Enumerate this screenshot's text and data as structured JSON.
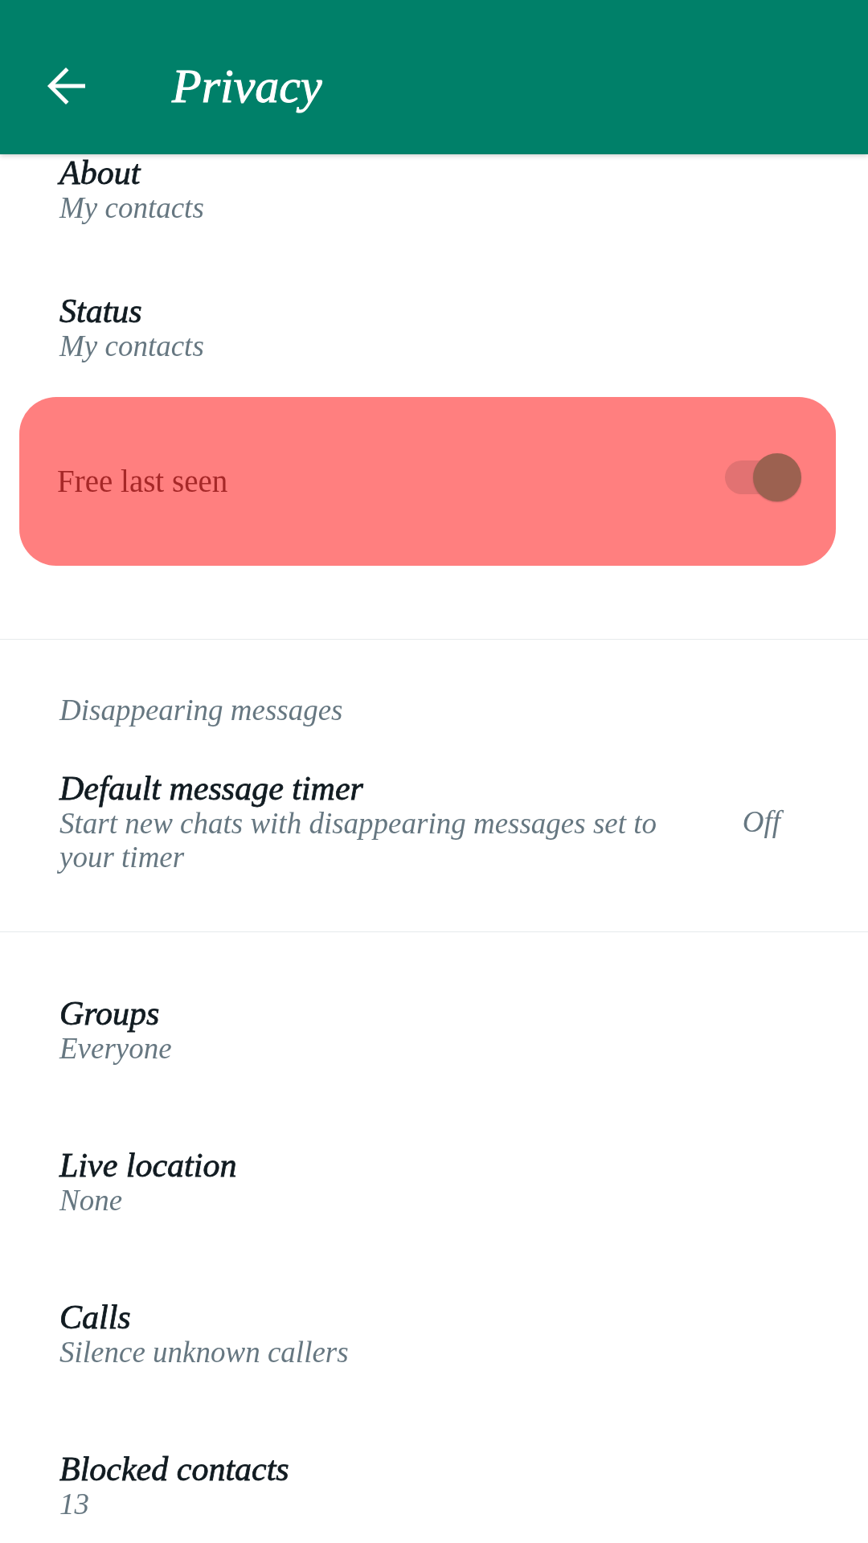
{
  "app_bar": {
    "title": "Privacy"
  },
  "sections": [
    {
      "items": [
        {
          "kind": "item",
          "title": "About",
          "subtitle": "My contacts"
        },
        {
          "kind": "item",
          "title": "Status",
          "subtitle": "My contacts"
        },
        {
          "kind": "toggle",
          "label": "Free last seen",
          "on": true
        }
      ]
    },
    {
      "header": "Disappearing messages",
      "items": [
        {
          "kind": "item",
          "title": "Default message timer",
          "subtitle": "Start new chats with disappearing messages set to your timer",
          "value": "Off"
        }
      ]
    },
    {
      "items": [
        {
          "kind": "item",
          "title": "Groups",
          "subtitle": "Everyone"
        },
        {
          "kind": "item",
          "title": "Live location",
          "subtitle": "None"
        },
        {
          "kind": "item",
          "title": "Calls",
          "subtitle": "Silence unknown callers"
        },
        {
          "kind": "item",
          "title": "Blocked contacts",
          "subtitle": "13"
        }
      ]
    }
  ]
}
